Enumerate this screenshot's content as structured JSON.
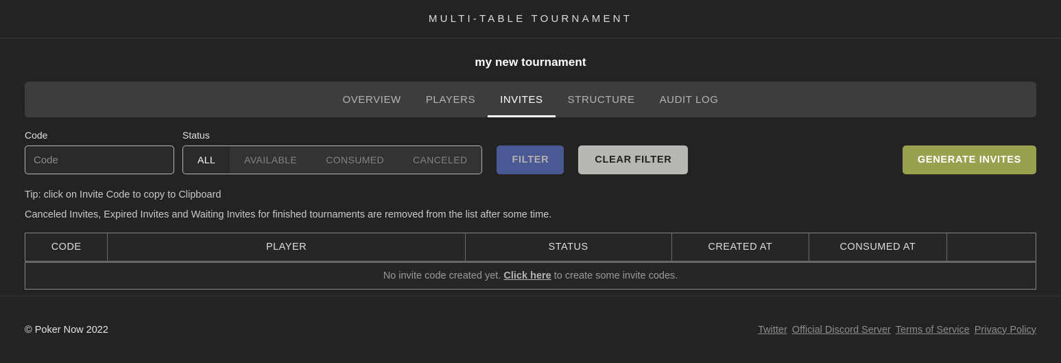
{
  "header": {
    "title": "MULTI-TABLE TOURNAMENT"
  },
  "tournament": {
    "name": "my new tournament"
  },
  "tabs": [
    {
      "label": "OVERVIEW",
      "active": false
    },
    {
      "label": "PLAYERS",
      "active": false
    },
    {
      "label": "INVITES",
      "active": true
    },
    {
      "label": "STRUCTURE",
      "active": false
    },
    {
      "label": "AUDIT LOG",
      "active": false
    }
  ],
  "filters": {
    "code_label": "Code",
    "code_value": "",
    "code_placeholder": "Code",
    "status_label": "Status",
    "status_options": [
      {
        "label": "ALL",
        "selected": true
      },
      {
        "label": "AVAILABLE",
        "selected": false
      },
      {
        "label": "CONSUMED",
        "selected": false
      },
      {
        "label": "CANCELED",
        "selected": false
      }
    ],
    "filter_button": "FILTER",
    "clear_button": "CLEAR FILTER",
    "generate_button": "GENERATE INVITES"
  },
  "tips": {
    "line1": "Tip: click on Invite Code to copy to Clipboard",
    "line2": "Canceled Invites, Expired Invites and Waiting Invites for finished tournaments are removed from the list after some time."
  },
  "table": {
    "columns": [
      "CODE",
      "PLAYER",
      "STATUS",
      "CREATED AT",
      "CONSUMED AT",
      ""
    ],
    "rows": [],
    "empty_prefix": "No invite code created yet. ",
    "empty_link": "Click here",
    "empty_suffix": " to create some invite codes."
  },
  "footer": {
    "copyright": "© Poker Now 2022",
    "links": [
      "Twitter",
      "Official Discord Server",
      "Terms of Service",
      "Privacy Policy"
    ]
  },
  "colors": {
    "page_bg": "#232323",
    "tabbar_bg": "#3d3d3d",
    "accent_filter": "#4a5894",
    "accent_generate": "#99a14f",
    "clear_button": "#b9b7b4"
  }
}
